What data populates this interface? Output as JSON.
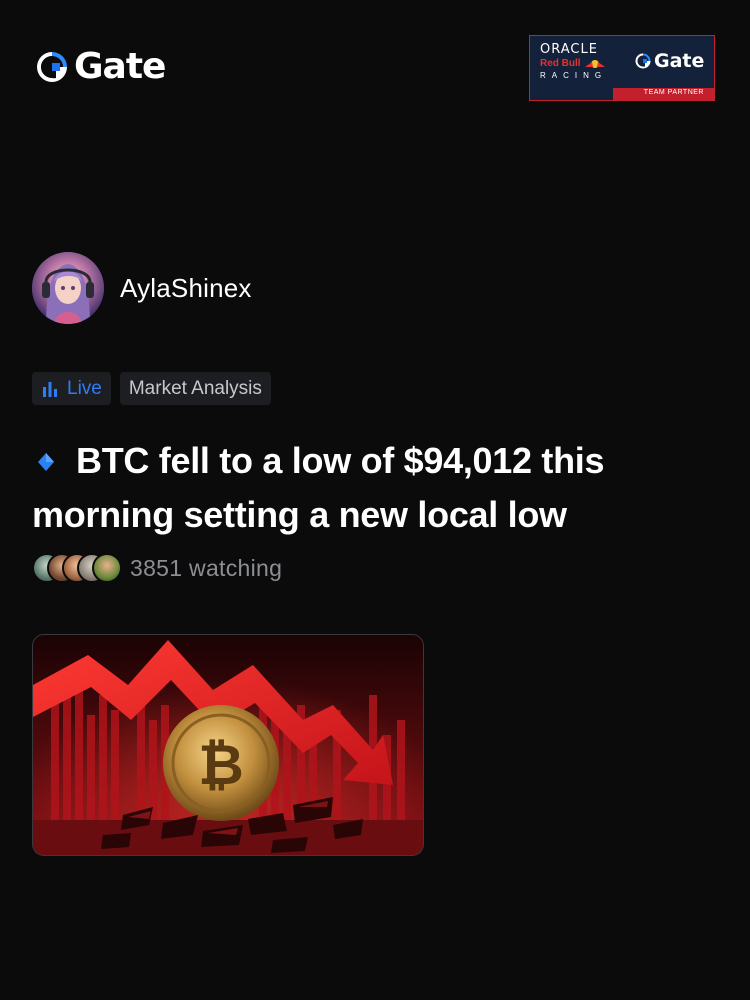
{
  "brand": {
    "name": "Gate",
    "accent": "#1e72f2"
  },
  "partner_badge": {
    "oracle": "ORACLE",
    "red_bull": "Red Bull",
    "racing": "RACING",
    "gate": "Gate",
    "team_partner": "TEAM PARTNER"
  },
  "author": {
    "name": "AylaShinex"
  },
  "tags": {
    "live": "Live",
    "category": "Market Analysis"
  },
  "post": {
    "title": "BTC fell to a low of $94,012 this morning setting a new local low"
  },
  "watching": {
    "count_text": "3851 watching"
  },
  "thumbnail": {
    "alt": "red crashing arrow over bitcoin coin"
  }
}
